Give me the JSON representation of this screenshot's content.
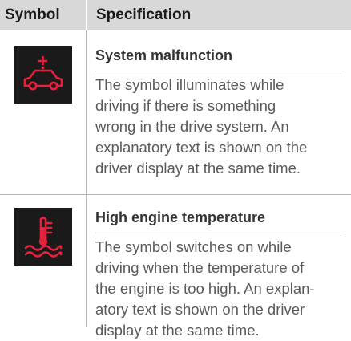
{
  "header": {
    "symbol_label": "Symbol",
    "spec_label": "Specification"
  },
  "colors": {
    "icon_background": "#1a1a1a",
    "warning_red": "#e8203c",
    "header_background": "#d8d8d8"
  },
  "rows": [
    {
      "icon": "car-system-malfunction-icon",
      "title": "System malfunction",
      "text": "The symbol illuminates while\ndriving if there is something\nwrong in the drive system. An\nexplanatory text is shown on the\ndriver display at the same time."
    },
    {
      "icon": "engine-temperature-icon",
      "title": "High engine temperature",
      "text": "The symbol switches on while\ndriving when the temperature of\nthe engine is too high. An explan-\natory text is shown on the driver\ndisplay at the same time."
    }
  ]
}
